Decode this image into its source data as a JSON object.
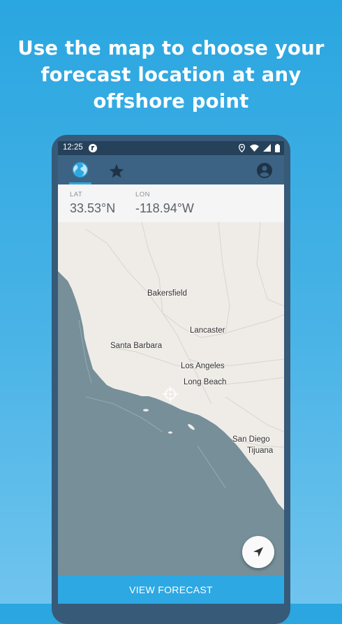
{
  "headline": {
    "line1": "Use the map to choose your",
    "line2": "forecast location at any",
    "line3": "offshore point"
  },
  "status_bar": {
    "time": "12:25"
  },
  "tabs": [
    {
      "icon": "globe-icon",
      "active": true
    },
    {
      "icon": "star-icon",
      "active": false
    }
  ],
  "account_icon": "account-circle-icon",
  "coordinates": {
    "lat_label": "LAT",
    "lat_value": "33.53°N",
    "lon_label": "LON",
    "lon_value": "-118.94°W"
  },
  "map": {
    "water_color": "#768f99",
    "land_color": "#efece8",
    "cities": {
      "bakersfield": "Bakersfield",
      "lancaster": "Lancaster",
      "santa_barbara": "Santa Barbara",
      "los_angeles": "Los Angeles",
      "long_beach": "Long Beach",
      "san_diego": "San Diego",
      "tijuana": "Tijuana"
    },
    "marker": "crosshair-icon"
  },
  "locate_button": {
    "icon": "navigation-arrow-icon"
  },
  "view_forecast_label": "VIEW FORECAST",
  "colors": {
    "accent": "#2da8e3",
    "appbar": "#3c6384",
    "statusbar": "#26415a",
    "background_top": "#2aa6e0",
    "background_bottom": "#6fc4ee"
  }
}
